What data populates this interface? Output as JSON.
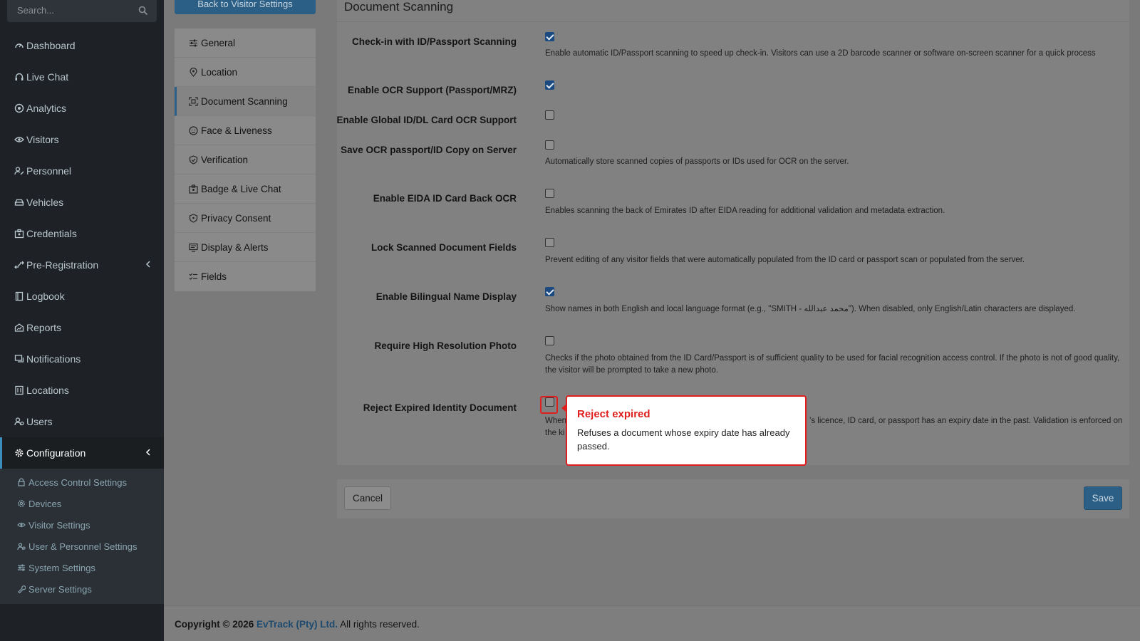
{
  "search": {
    "placeholder": "Search..."
  },
  "sidebar": {
    "items": [
      {
        "label": "Dashboard",
        "icon": "dashboard-icon"
      },
      {
        "label": "Live Chat",
        "icon": "headset-icon"
      },
      {
        "label": "Analytics",
        "icon": "target-icon"
      },
      {
        "label": "Visitors",
        "icon": "eye-icon"
      },
      {
        "label": "Personnel",
        "icon": "user-edit-icon"
      },
      {
        "label": "Vehicles",
        "icon": "car-icon"
      },
      {
        "label": "Credentials",
        "icon": "id-card-icon"
      },
      {
        "label": "Pre-Registration",
        "icon": "arrows-icon"
      },
      {
        "label": "Logbook",
        "icon": "book-icon"
      },
      {
        "label": "Reports",
        "icon": "chart-icon"
      },
      {
        "label": "Notifications",
        "icon": "message-icon"
      },
      {
        "label": "Locations",
        "icon": "building-icon"
      },
      {
        "label": "Users",
        "icon": "users-icon"
      },
      {
        "label": "Configuration",
        "icon": "gear-icon"
      }
    ],
    "sub_items": [
      {
        "label": "Access Control Settings",
        "icon": "lock-icon"
      },
      {
        "label": "Devices",
        "icon": "gear-icon"
      },
      {
        "label": "Visitor Settings",
        "icon": "eye-icon"
      },
      {
        "label": "User & Personnel Settings",
        "icon": "users-icon"
      },
      {
        "label": "System Settings",
        "icon": "sliders-icon"
      },
      {
        "label": "Server Settings",
        "icon": "wrench-icon"
      }
    ]
  },
  "back_button": "Back to Visitor Settings",
  "tabs": [
    {
      "label": "General",
      "icon": "sliders-icon"
    },
    {
      "label": "Location",
      "icon": "pin-icon"
    },
    {
      "label": "Document Scanning",
      "icon": "scan-icon"
    },
    {
      "label": "Face & Liveness",
      "icon": "face-icon"
    },
    {
      "label": "Verification",
      "icon": "shield-check-icon"
    },
    {
      "label": "Badge & Live Chat",
      "icon": "badge-icon"
    },
    {
      "label": "Privacy Consent",
      "icon": "shield-icon"
    },
    {
      "label": "Display & Alerts",
      "icon": "display-icon"
    },
    {
      "label": "Fields",
      "icon": "list-check-icon"
    }
  ],
  "panel": {
    "title": "Document Scanning",
    "settings": [
      {
        "label": "Check-in with ID/Passport Scanning",
        "checked": true,
        "help": "Enable automatic ID/Passport scanning to speed up check-in. Visitors can use a 2D barcode scanner or software on-screen scanner for a quick process"
      },
      {
        "label": "Enable OCR Support (Passport/MRZ)",
        "checked": true,
        "help": ""
      },
      {
        "label": "Enable Global ID/DL Card OCR Support",
        "checked": false,
        "help": ""
      },
      {
        "label": "Save OCR passport/ID Copy on Server",
        "checked": false,
        "help": "Automatically store scanned copies of passports or IDs used for OCR on the server."
      },
      {
        "label": "Enable EIDA ID Card Back OCR",
        "checked": false,
        "help": "Enables scanning the back of Emirates ID after EIDA reading for additional validation and metadata extraction."
      },
      {
        "label": "Lock Scanned Document Fields",
        "checked": false,
        "help": "Prevent editing of any visitor fields that were automatically populated from the ID card or passport scan or populated from the server."
      },
      {
        "label": "Enable Bilingual Name Display",
        "checked": true,
        "help": "Show names in both English and local language format (e.g., \"SMITH - محمد عبدالله\"). When disabled, only English/Latin characters are displayed."
      },
      {
        "label": "Require High Resolution Photo",
        "checked": false,
        "help": "Checks if the photo obtained from the ID Card/Passport is of sufficient quality to be used for facial recognition access control. If the photo is not of good quality, the visitor will be prompted to take a new photo."
      },
      {
        "label": "Reject Expired Identity Document",
        "checked": false,
        "help_left": "When",
        "help_right": "’s licence, ID card, or passport has an expiry date in the past. Validation is enforced on",
        "help_line2": "the ki"
      }
    ]
  },
  "tooltip": {
    "title": "Reject expired",
    "body": "Refuses a document whose expiry date has already passed."
  },
  "actions": {
    "cancel": "Cancel",
    "save": "Save"
  },
  "footer": {
    "prefix": "Copyright © 2026",
    "brand": "EvTrack (Pty) Ltd.",
    "suffix": "All rights reserved."
  },
  "colors": {
    "accent": "#3c8dbc",
    "primary_button": "#2c5f86",
    "tooltip_border": "#e01e1e",
    "sidebar_bg": "#1e2226"
  }
}
